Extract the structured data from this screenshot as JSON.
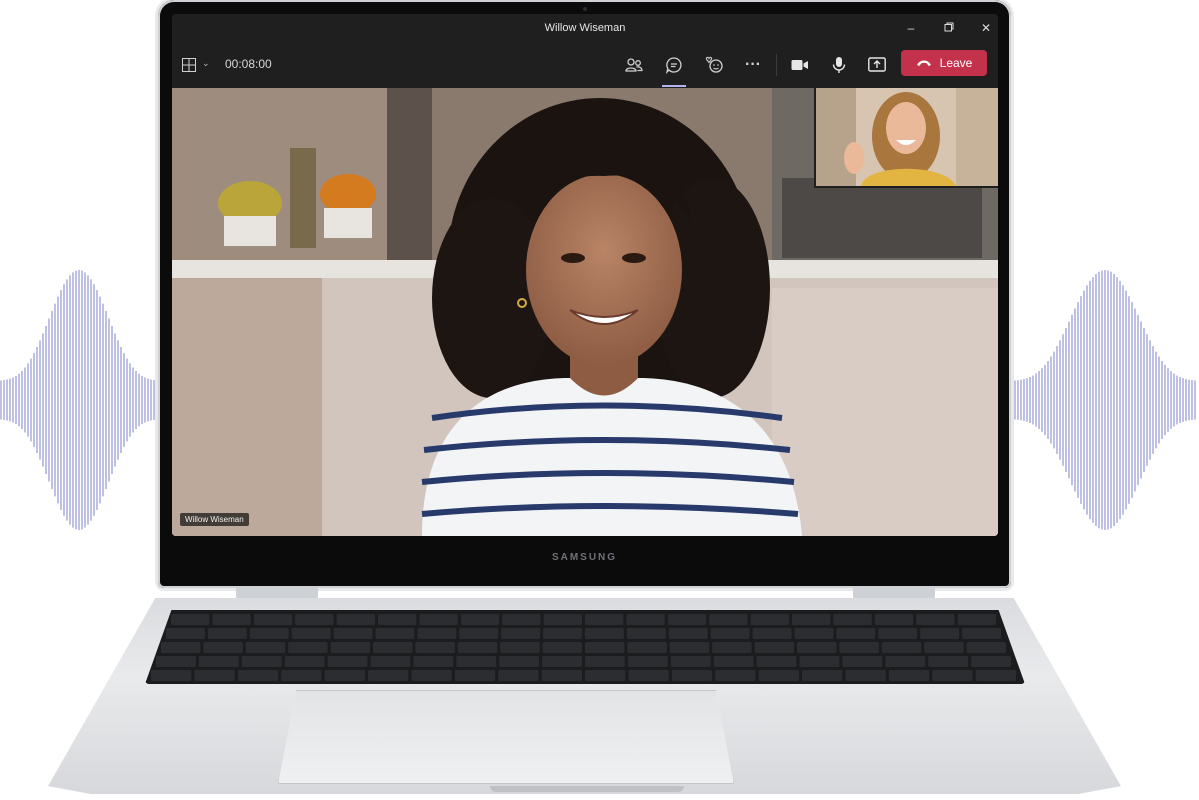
{
  "window": {
    "title": "Willow Wiseman",
    "minimize_icon": "minimize-icon",
    "restore_icon": "restore-icon",
    "close_icon": "close-icon"
  },
  "toolbar": {
    "timer": "00:08:00",
    "layout_icon": "grid-layout-icon",
    "people_icon": "people-icon",
    "chat_icon": "chat-icon",
    "reactions_icon": "reactions-icon",
    "more_icon": "more-icon",
    "camera_icon": "video-camera-icon",
    "mic_icon": "microphone-icon",
    "share_icon": "share-screen-icon",
    "leave_label": "Leave",
    "leave_color": "#c4314b"
  },
  "stage": {
    "speaker_name": "Willow Wiseman"
  },
  "device": {
    "brand": "SAMSUNG"
  }
}
